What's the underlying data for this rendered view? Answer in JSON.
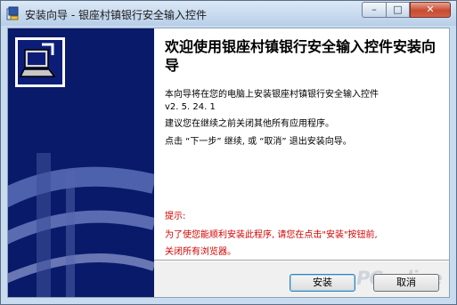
{
  "window": {
    "title": "安装向导 - 银座村镇银行安全输入控件",
    "controls": {
      "minimize": "–",
      "maximize": "□",
      "close": "✕"
    }
  },
  "wizard": {
    "heading": "欢迎使用银座村镇银行安全输入控件安装向导",
    "intro_line1": "本向导将在您的电脑上安装银座村镇银行安全输入控件",
    "version": "v2. 5. 24. 1",
    "advice": "建议您在继续之前关闭其他所有应用程序。",
    "instruction": "点击 “下一步” 继续, 或 “取消” 退出安装向导。",
    "tips_title": "提示:",
    "tips_line1": "为了使您能顺利安装此程序, 请您在点击\"安装\"按钮前,",
    "tips_line2": "关闭所有浏览器。"
  },
  "buttons": {
    "install": "安装",
    "cancel": "取消"
  },
  "watermark": "PConline",
  "colors": {
    "banner": "#0a1a6a",
    "tips": "#d40000"
  }
}
